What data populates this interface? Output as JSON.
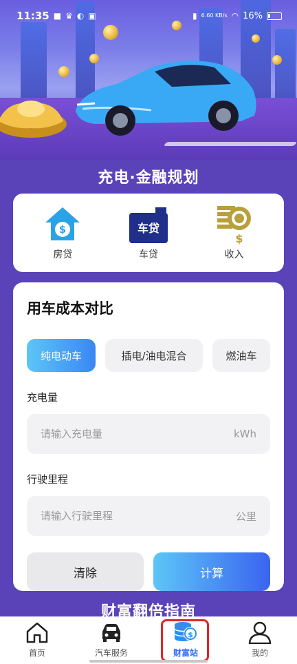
{
  "status_bar": {
    "time": "11:35",
    "net_speed": "6.60 KB/s",
    "battery": "16%"
  },
  "hero": {
    "title": "充电·金融规划"
  },
  "quick_links": [
    {
      "label": "房贷",
      "icon": "house-dollar-icon"
    },
    {
      "label": "车贷",
      "icon": "car-loan-icon",
      "icon_text": "车贷"
    },
    {
      "label": "收入",
      "icon": "coin-income-icon"
    }
  ],
  "cost": {
    "title": "用车成本对比",
    "tabs": [
      "纯电动车",
      "插电/油电混合",
      "燃油车"
    ],
    "active_tab": "纯电动车",
    "fields": [
      {
        "label": "充电量",
        "placeholder": "请输入充电量",
        "unit": "kWh",
        "value": ""
      },
      {
        "label": "行驶里程",
        "placeholder": "请输入行驶里程",
        "unit": "公里",
        "value": ""
      }
    ],
    "clear_label": "清除",
    "calc_label": "计算"
  },
  "next_section_title": "财富翻倍指南",
  "nav": {
    "items": [
      {
        "label": "首页",
        "icon": "home-icon"
      },
      {
        "label": "汽车服务",
        "icon": "car-icon"
      },
      {
        "label": "财富站",
        "icon": "wealth-icon"
      },
      {
        "label": "我的",
        "icon": "user-icon"
      }
    ],
    "active": "财富站"
  },
  "colors": {
    "background": "#5a43b8",
    "accent_blue": "#3a86f5",
    "highlight_red": "#e0262b",
    "gold": "#b8a03a"
  }
}
